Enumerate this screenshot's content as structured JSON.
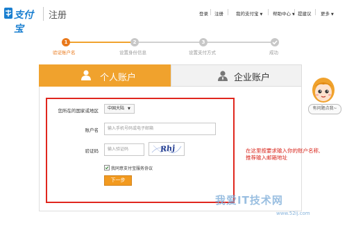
{
  "header": {
    "logo_text": "支付宝",
    "page_title": "注册",
    "nav": [
      "登录",
      "注册",
      "我的支付宝",
      "帮助中心",
      "提建议",
      "更多"
    ]
  },
  "steps": [
    {
      "num": "1",
      "label": "验证账户名",
      "active": true
    },
    {
      "num": "2",
      "label": "设置身份信息",
      "active": false
    },
    {
      "num": "3",
      "label": "设置支付方式",
      "active": false
    },
    {
      "num": "",
      "label": "成功",
      "active": false
    }
  ],
  "tabs": {
    "personal": "个人账户",
    "business": "企业账户"
  },
  "form": {
    "country_label": "您所在的国家或地区",
    "country_value": "中国大陆",
    "account_label": "账户名",
    "account_placeholder": "输入手机号码或电子邮箱",
    "code_label": "验证码",
    "code_placeholder": "输入验证码",
    "captcha_text": "Rhj",
    "agree_text": "我同意支付宝服务协议",
    "next_label": "下一步"
  },
  "annotation": {
    "line1": "在这里按要求输入你的账户名称,",
    "line2": "推荐输入邮箱地址"
  },
  "helper": {
    "button_label": "有问题点我~"
  },
  "watermark": {
    "text": "我爱IT技术网",
    "url": "www.52ij.com"
  },
  "colors": {
    "brand_blue": "#1a7fd0",
    "accent_orange": "#f0a22d",
    "highlight_red": "#e0261d"
  }
}
